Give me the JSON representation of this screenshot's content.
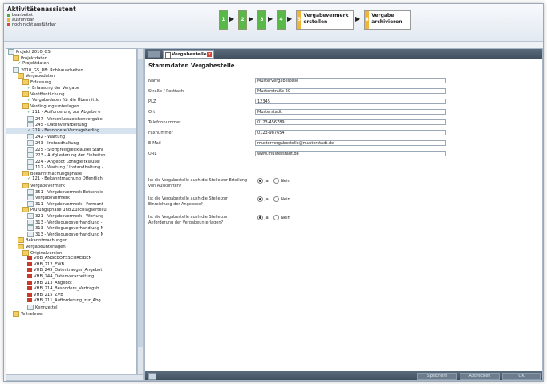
{
  "assistant": {
    "title": "Aktivitätenassistent",
    "legend": [
      {
        "label": "bearbeitet",
        "color": "#4caf3c"
      },
      {
        "label": "ausführbar",
        "color": "#f0b63a"
      },
      {
        "label": "noch nicht ausführbar",
        "color": "#d8483a"
      }
    ],
    "steps": [
      {
        "num": "1"
      },
      {
        "num": "2"
      },
      {
        "num": "3"
      },
      {
        "num": "4"
      },
      {
        "num": "5",
        "label": "Vergabevermerk erstellen"
      },
      {
        "num": "6",
        "label": "Vergabe archivieren"
      }
    ]
  },
  "tree": [
    {
      "label": "Projekt 2010_GS",
      "icon": "project",
      "indent": 0
    },
    {
      "label": "Projektdaten",
      "icon": "folder",
      "indent": 1
    },
    {
      "label": "Projektdaten",
      "icon": "check",
      "indent": 2
    },
    {
      "label": "2010_GS_RB: Rohbauarbeiten",
      "icon": "project",
      "indent": 1
    },
    {
      "label": "Vergabedaten",
      "icon": "folder",
      "indent": 2
    },
    {
      "label": "Erfassung",
      "icon": "folder",
      "indent": 3
    },
    {
      "label": "Erfassung der Vergabe",
      "icon": "check",
      "indent": 4
    },
    {
      "label": "Veröffentlichung",
      "icon": "folder",
      "indent": 3
    },
    {
      "label": "Vergabedaten für die Übermittlu",
      "icon": "check",
      "indent": 4
    },
    {
      "label": "Verdingungsunterlagen",
      "icon": "folder",
      "indent": 3
    },
    {
      "label": "211 - Aufforderung zur Abgabe e",
      "icon": "check",
      "indent": 4
    },
    {
      "label": "247 - Verschlusszeichenvergabe",
      "icon": "doc",
      "indent": 4
    },
    {
      "label": "245 - Datenverarbeitung",
      "icon": "doc",
      "indent": 4
    },
    {
      "label": "214 - Besondere Vertragsbeding",
      "icon": "check",
      "indent": 4,
      "selected": true
    },
    {
      "label": "242 - Wartung",
      "icon": "doc",
      "indent": 4
    },
    {
      "label": "243 - Instandhaltung",
      "icon": "doc",
      "indent": 4
    },
    {
      "label": "225 - Stoffpreisgleitklausel Stahl",
      "icon": "doc",
      "indent": 4
    },
    {
      "label": "223 - Aufgliederung der Einheitsp",
      "icon": "doc",
      "indent": 4
    },
    {
      "label": "224 - Angebot Lohngleitklausel",
      "icon": "doc",
      "indent": 4
    },
    {
      "label": "112 - Wartung / Instandhaltung -",
      "icon": "doc",
      "indent": 4
    },
    {
      "label": "Bekanntmachungsphase",
      "icon": "folder",
      "indent": 3
    },
    {
      "label": "121 - Bekanntmachung Öffentlich",
      "icon": "check",
      "indent": 4
    },
    {
      "label": "Vergabevermerk",
      "icon": "folder",
      "indent": 3
    },
    {
      "label": "351 - Vergabevermerk Entscheid",
      "icon": "doc",
      "indent": 4
    },
    {
      "label": "Vergabevermerk",
      "icon": "doc",
      "indent": 4
    },
    {
      "label": "311 - Vergabevermerk - Formant",
      "icon": "doc",
      "indent": 4
    },
    {
      "label": "Prüfungsphase und Zuschlagserteilu",
      "icon": "folder",
      "indent": 3
    },
    {
      "label": "321 - Vergabevermerk - Wertung",
      "icon": "doc",
      "indent": 4
    },
    {
      "label": "313 - Verdingungsverhandlung -",
      "icon": "doc",
      "indent": 4
    },
    {
      "label": "313 - Verdingungsverhandlung N",
      "icon": "doc",
      "indent": 4
    },
    {
      "label": "313 - Verdingungsverhandlung N",
      "icon": "doc",
      "indent": 4
    },
    {
      "label": "Bekanntmachungen",
      "icon": "folder",
      "indent": 2
    },
    {
      "label": "Vergabeunterlagen",
      "icon": "folder",
      "indent": 2
    },
    {
      "label": "Originalversion",
      "icon": "folder",
      "indent": 3
    },
    {
      "label": "VOB_ANGEBOTSSCHREIBEN",
      "icon": "pdf",
      "indent": 4
    },
    {
      "label": "VHB_212_EWB",
      "icon": "pdf",
      "indent": 4
    },
    {
      "label": "VHB_245_Datentraeger_Angebot",
      "icon": "pdf",
      "indent": 4
    },
    {
      "label": "VHB_244_Datenverarbeitung",
      "icon": "pdf",
      "indent": 4
    },
    {
      "label": "VHB_213_Angebot",
      "icon": "pdf",
      "indent": 4
    },
    {
      "label": "VHB_214_Besondere_Vertragsb",
      "icon": "pdf",
      "indent": 4
    },
    {
      "label": "VHB_215_ZVB",
      "icon": "pdf",
      "indent": 4
    },
    {
      "label": "VHB_211_Aufforderung_zur_Abg",
      "icon": "pdf",
      "indent": 4
    },
    {
      "label": "Kennzettel",
      "icon": "doc",
      "indent": 4
    },
    {
      "label": "Teilnehmer",
      "icon": "folder",
      "indent": 1
    }
  ],
  "panel": {
    "tab_label": "Vergabestelle",
    "heading": "Stammdaten Vergabestelle",
    "fields": [
      {
        "label": "Name",
        "value": "Mustervergabestelle"
      },
      {
        "label": "Straße / Postfach",
        "value": "Musterstraße 20"
      },
      {
        "label": "PLZ",
        "value": "12345"
      },
      {
        "label": "Ort",
        "value": "Musterstadt"
      },
      {
        "label": "Telefonnummer",
        "value": "0123-456789"
      },
      {
        "label": "Faxnummer",
        "value": "0123-987654"
      },
      {
        "label": "E-Mail",
        "value": "mustervergabestelle@musterstadt.de"
      },
      {
        "label": "URL",
        "value": "www.musterstadt.de"
      }
    ],
    "questions": [
      {
        "text": "Ist die Vergabestelle auch die Stelle zur Erteilung von Auskünften?",
        "yes": "Ja",
        "no": "Nein",
        "selected": "yes"
      },
      {
        "text": "Ist die Vergabestelle auch die Stelle zur Einreichung der Angebote?",
        "yes": "Ja",
        "no": "Nein",
        "selected": "yes"
      },
      {
        "text": "Ist die Vergabestelle auch die Stelle zur Anforderung der Vergabeunterlagen?",
        "yes": "Ja",
        "no": "Nein",
        "selected": "yes"
      }
    ],
    "buttons": {
      "save": "Speichern",
      "cancel": "Abbrechen",
      "ok": "OK"
    }
  }
}
